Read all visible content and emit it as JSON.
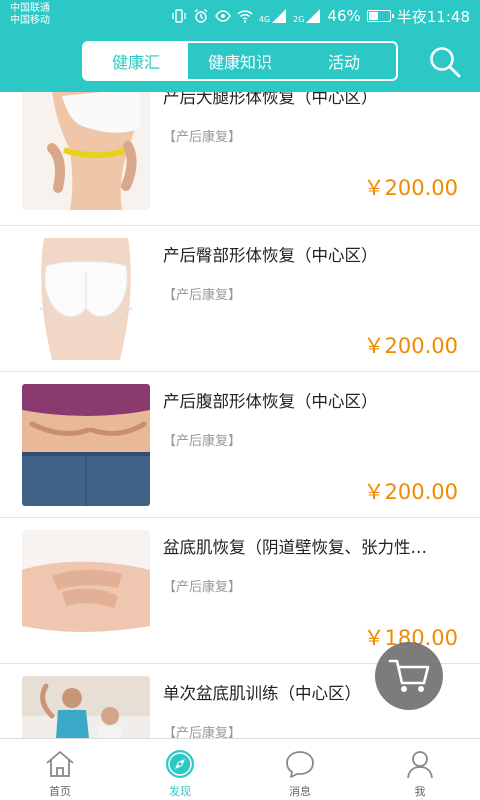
{
  "status_bar": {
    "carrier1": "中国联通",
    "carrier2": "中国移动",
    "network1": "4G",
    "network2": "2G",
    "battery_percent": "46%",
    "battery_level": 0.46,
    "time": "半夜11:48"
  },
  "header": {
    "tabs": [
      {
        "label": "健康汇",
        "active": true
      },
      {
        "label": "健康知识",
        "active": false
      },
      {
        "label": "活动",
        "active": false
      }
    ],
    "search_icon": "search-icon"
  },
  "products": [
    {
      "title": "产后大腿形体恢复（中心区）",
      "tag": "【产后康复】",
      "price": "￥200.00"
    },
    {
      "title": "产后臀部形体恢复（中心区）",
      "tag": "【产后康复】",
      "price": "￥200.00"
    },
    {
      "title": "产后腹部形体恢复（中心区）",
      "tag": "【产后康复】",
      "price": "￥200.00"
    },
    {
      "title": "盆底肌恢复（阴道壁恢复、张力性…",
      "tag": "【产后康复】",
      "price": "￥180.00"
    },
    {
      "title": "单次盆底肌训练（中心区）",
      "tag": "【产后康复】",
      "price": ""
    }
  ],
  "cart": {
    "icon": "shopping-cart-icon"
  },
  "bottom_nav": [
    {
      "label": "首页",
      "icon": "home-icon",
      "active": false
    },
    {
      "label": "发现",
      "icon": "discover-icon",
      "active": true
    },
    {
      "label": "消息",
      "icon": "chat-icon",
      "active": false
    },
    {
      "label": "我",
      "icon": "user-icon",
      "active": false
    }
  ],
  "colors": {
    "accent": "#2bc8c6",
    "price": "#f08a00",
    "tag": "#999999"
  }
}
